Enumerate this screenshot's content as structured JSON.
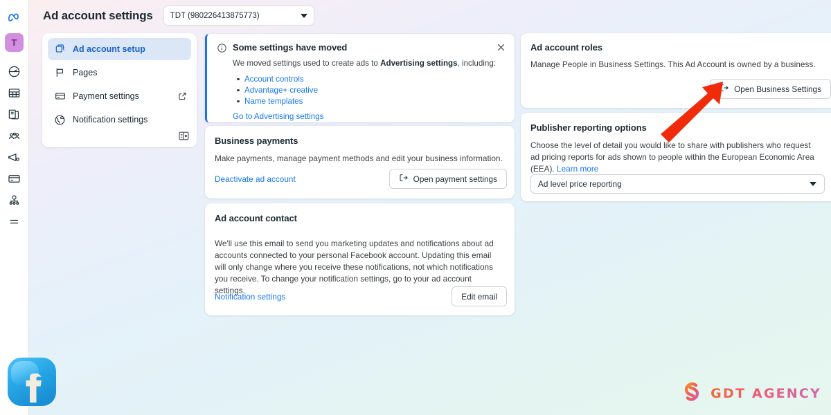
{
  "header": {
    "title": "Ad account settings",
    "account_select": {
      "value": "TDT (980226413875773)",
      "caret_icon": "chevron-down-icon"
    }
  },
  "rail": {
    "logo_icon": "meta-logo-icon",
    "avatar_initial": "T",
    "items": [
      {
        "icon": "speedometer-icon",
        "name": "dashboard"
      },
      {
        "icon": "table-icon",
        "name": "table"
      },
      {
        "icon": "pages-icon",
        "name": "pages"
      },
      {
        "icon": "audience-icon",
        "name": "audiences"
      },
      {
        "icon": "megaphone-icon",
        "name": "ads"
      },
      {
        "icon": "credit-card-icon",
        "name": "billing"
      },
      {
        "icon": "share-node-icon",
        "name": "connections"
      },
      {
        "icon": "hamburger-menu-icon",
        "name": "more"
      }
    ]
  },
  "nav": {
    "items": [
      {
        "label": "Ad account setup",
        "icon": "ad-account-icon",
        "active": true,
        "external": false
      },
      {
        "label": "Pages",
        "icon": "flag-icon",
        "active": false,
        "external": false
      },
      {
        "label": "Payment settings",
        "icon": "credit-card-icon",
        "active": false,
        "external": true
      },
      {
        "label": "Notification settings",
        "icon": "globe-icon",
        "active": false,
        "external": false
      }
    ],
    "collapse_icon": "collapse-panel-icon"
  },
  "moved_notice": {
    "info_icon": "info-circle-icon",
    "close_icon": "close-icon",
    "title": "Some settings have moved",
    "description_prefix": "We moved settings used to create ads to ",
    "description_bold": "Advertising settings",
    "description_suffix": ", including:",
    "items": [
      "Account controls",
      "Advantage+ creative",
      "Name templates"
    ],
    "cta": "Go to Advertising settings"
  },
  "business_payments": {
    "title": "Business payments",
    "description": "Make payments, manage payment methods and edit your business information.",
    "link": "Deactivate ad account",
    "button": "Open payment settings",
    "button_icon": "external-link-icon"
  },
  "ad_account_contact": {
    "title": "Ad account contact",
    "description": "We'll use this email to send you marketing updates and notifications about ad accounts connected to your personal Facebook account. Updating this email will only change where you receive these notifications, not which notifications you receive. To change your notification settings, go to your ad account settings.",
    "link": "Notification settings",
    "button": "Edit email"
  },
  "ad_account_roles": {
    "title": "Ad account roles",
    "description": "Manage People in Business Settings. This Ad Account is owned by a business.",
    "button": "Open Business Settings",
    "button_icon": "external-link-icon"
  },
  "publisher_reporting": {
    "title": "Publisher reporting options",
    "description": "Choose the level of detail you would like to share with publishers who request ad pricing reports for ads shown to people within the European Economic Area (EEA). ",
    "learn_more": "Learn more",
    "select_value": "Ad level price reporting",
    "select_caret_icon": "chevron-down-icon"
  },
  "annotations": {
    "arrow_icon": "red-arrow-pointing-up-right",
    "arrow_color": "#f02b0a"
  },
  "watermarks": {
    "facebook_icon": "facebook-logo-icon",
    "brand_text": "GDT AGENCY",
    "brand_mark_icon": "gdt-monogram-icon"
  },
  "colors": {
    "accent_blue": "#1877f2",
    "notice_border": "#1b74e4",
    "active_nav_bg": "#dbe7f6",
    "active_nav_text": "#1b62c4",
    "avatar_bg": "#d28fe0"
  }
}
